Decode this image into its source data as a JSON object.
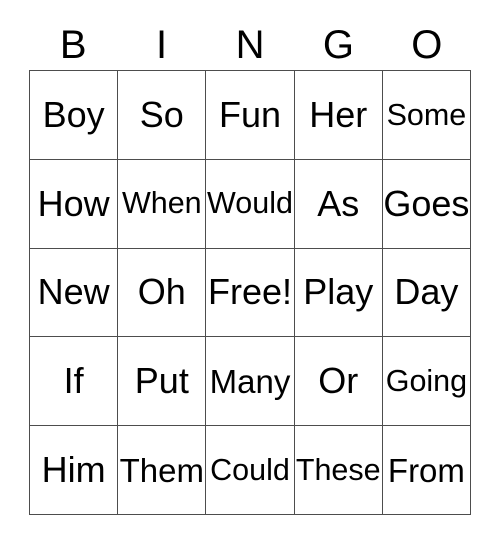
{
  "card": {
    "title": "BINGO",
    "columns": [
      {
        "letter": "B"
      },
      {
        "letter": "I"
      },
      {
        "letter": "N"
      },
      {
        "letter": "G"
      },
      {
        "letter": "O"
      }
    ],
    "rows": [
      [
        {
          "word": "Boy",
          "fit": "lg"
        },
        {
          "word": "So",
          "fit": "lg"
        },
        {
          "word": "Fun",
          "fit": "lg"
        },
        {
          "word": "Her",
          "fit": "lg"
        },
        {
          "word": "Some",
          "fit": "sm"
        }
      ],
      [
        {
          "word": "How",
          "fit": "lg"
        },
        {
          "word": "When",
          "fit": "sm"
        },
        {
          "word": "Would",
          "fit": "sm"
        },
        {
          "word": "As",
          "fit": "lg"
        },
        {
          "word": "Goes",
          "fit": "lg"
        }
      ],
      [
        {
          "word": "New",
          "fit": "lg"
        },
        {
          "word": "Oh",
          "fit": "lg"
        },
        {
          "word": "Free!",
          "fit": "lg"
        },
        {
          "word": "Play",
          "fit": "lg"
        },
        {
          "word": "Day",
          "fit": "lg"
        }
      ],
      [
        {
          "word": "If",
          "fit": "lg"
        },
        {
          "word": "Put",
          "fit": "lg"
        },
        {
          "word": "Many",
          "fit": "md"
        },
        {
          "word": "Or",
          "fit": "lg"
        },
        {
          "word": "Going",
          "fit": "sm"
        }
      ],
      [
        {
          "word": "Him",
          "fit": "lg"
        },
        {
          "word": "Them",
          "fit": "md"
        },
        {
          "word": "Could",
          "fit": "sm"
        },
        {
          "word": "These",
          "fit": "sm"
        },
        {
          "word": "From",
          "fit": "md"
        }
      ]
    ],
    "free_space_word": "Free!",
    "colors": {
      "background": "#ffffff",
      "border": "#4d4d4d",
      "text": "#000000"
    }
  }
}
